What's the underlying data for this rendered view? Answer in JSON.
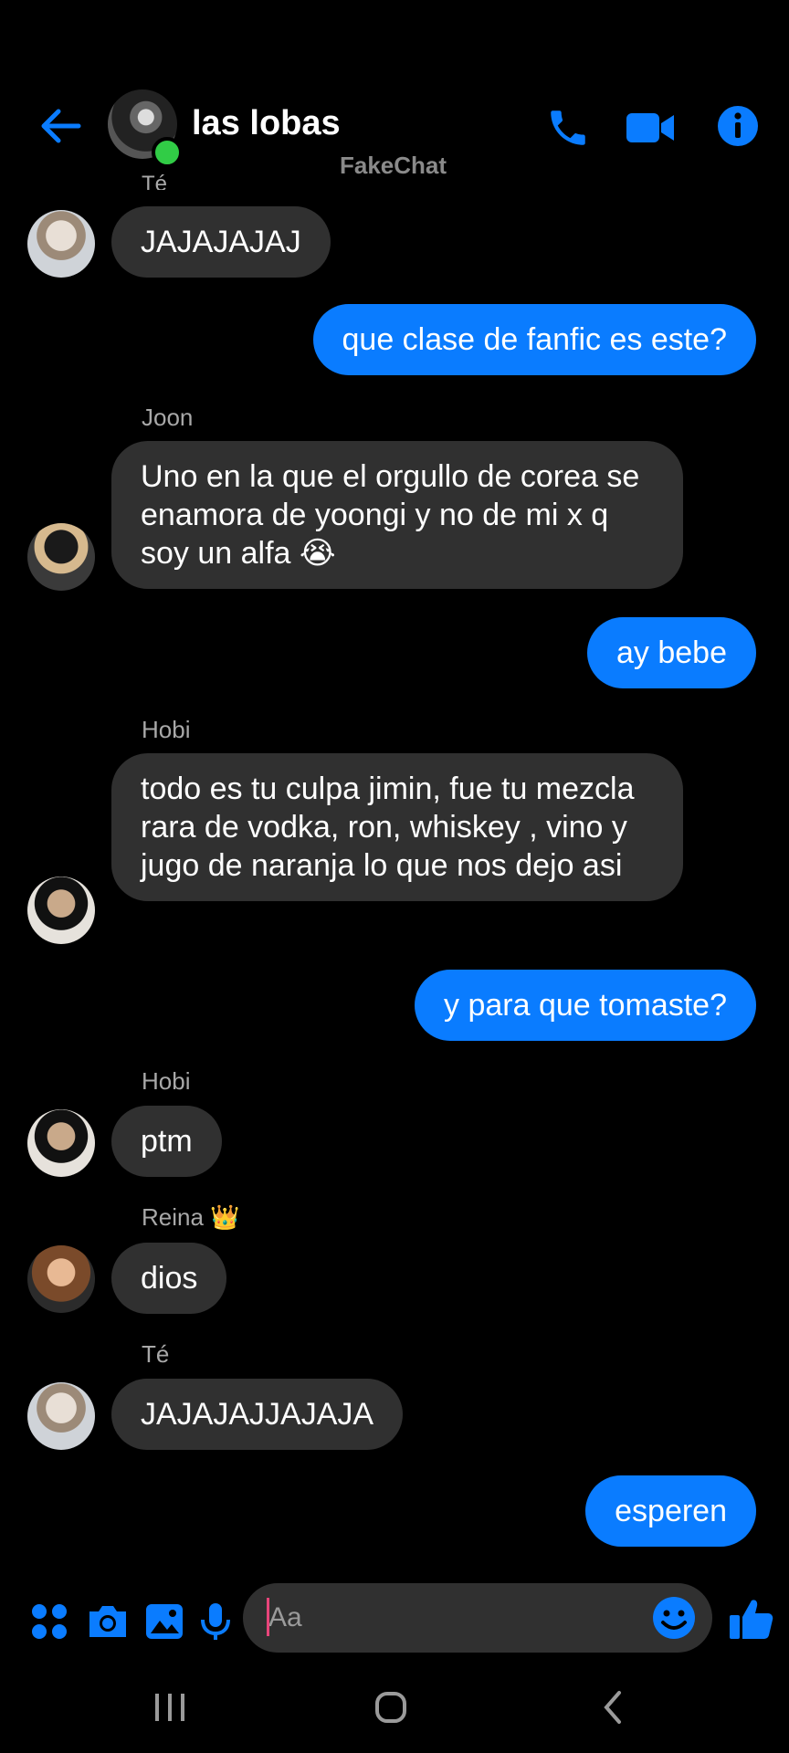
{
  "header": {
    "title": "las lobas",
    "watermark": "FakeChat",
    "cut_sender": "Té"
  },
  "colors": {
    "accent": "#0a7cff",
    "incoming_bubble": "#303030",
    "online": "#31cc46"
  },
  "icons": {
    "back": "arrow-left-icon",
    "call": "phone-icon",
    "video": "video-camera-icon",
    "info": "info-icon"
  },
  "messages": {
    "m1": {
      "text": "JAJAJAJAJ"
    },
    "m2": {
      "text": "que clase de fanfic es este?"
    },
    "m3": {
      "sender": "Joon",
      "text": "Uno en la que el orgullo de corea se enamora de yoongi y no de mi x q soy un alfa 😭"
    },
    "m4": {
      "text": "ay bebe"
    },
    "m5": {
      "sender": "Hobi",
      "text": "todo es tu culpa jimin, fue tu mezcla rara de vodka, ron, whiskey , vino y jugo de naranja lo que nos dejo asi"
    },
    "m6": {
      "text": "y para que tomaste?"
    },
    "m7": {
      "sender": "Hobi",
      "text": "ptm"
    },
    "m8": {
      "sender": "Reina 👑",
      "text": "dios"
    },
    "m9": {
      "sender": "Té",
      "text": "JAJAJAJJAJAJA"
    },
    "m10": {
      "text": "esperen"
    }
  },
  "composer": {
    "placeholder": "Aa"
  },
  "system_nav": {
    "recents": "recents-icon",
    "home": "home-icon",
    "back": "back-chevron-icon"
  }
}
